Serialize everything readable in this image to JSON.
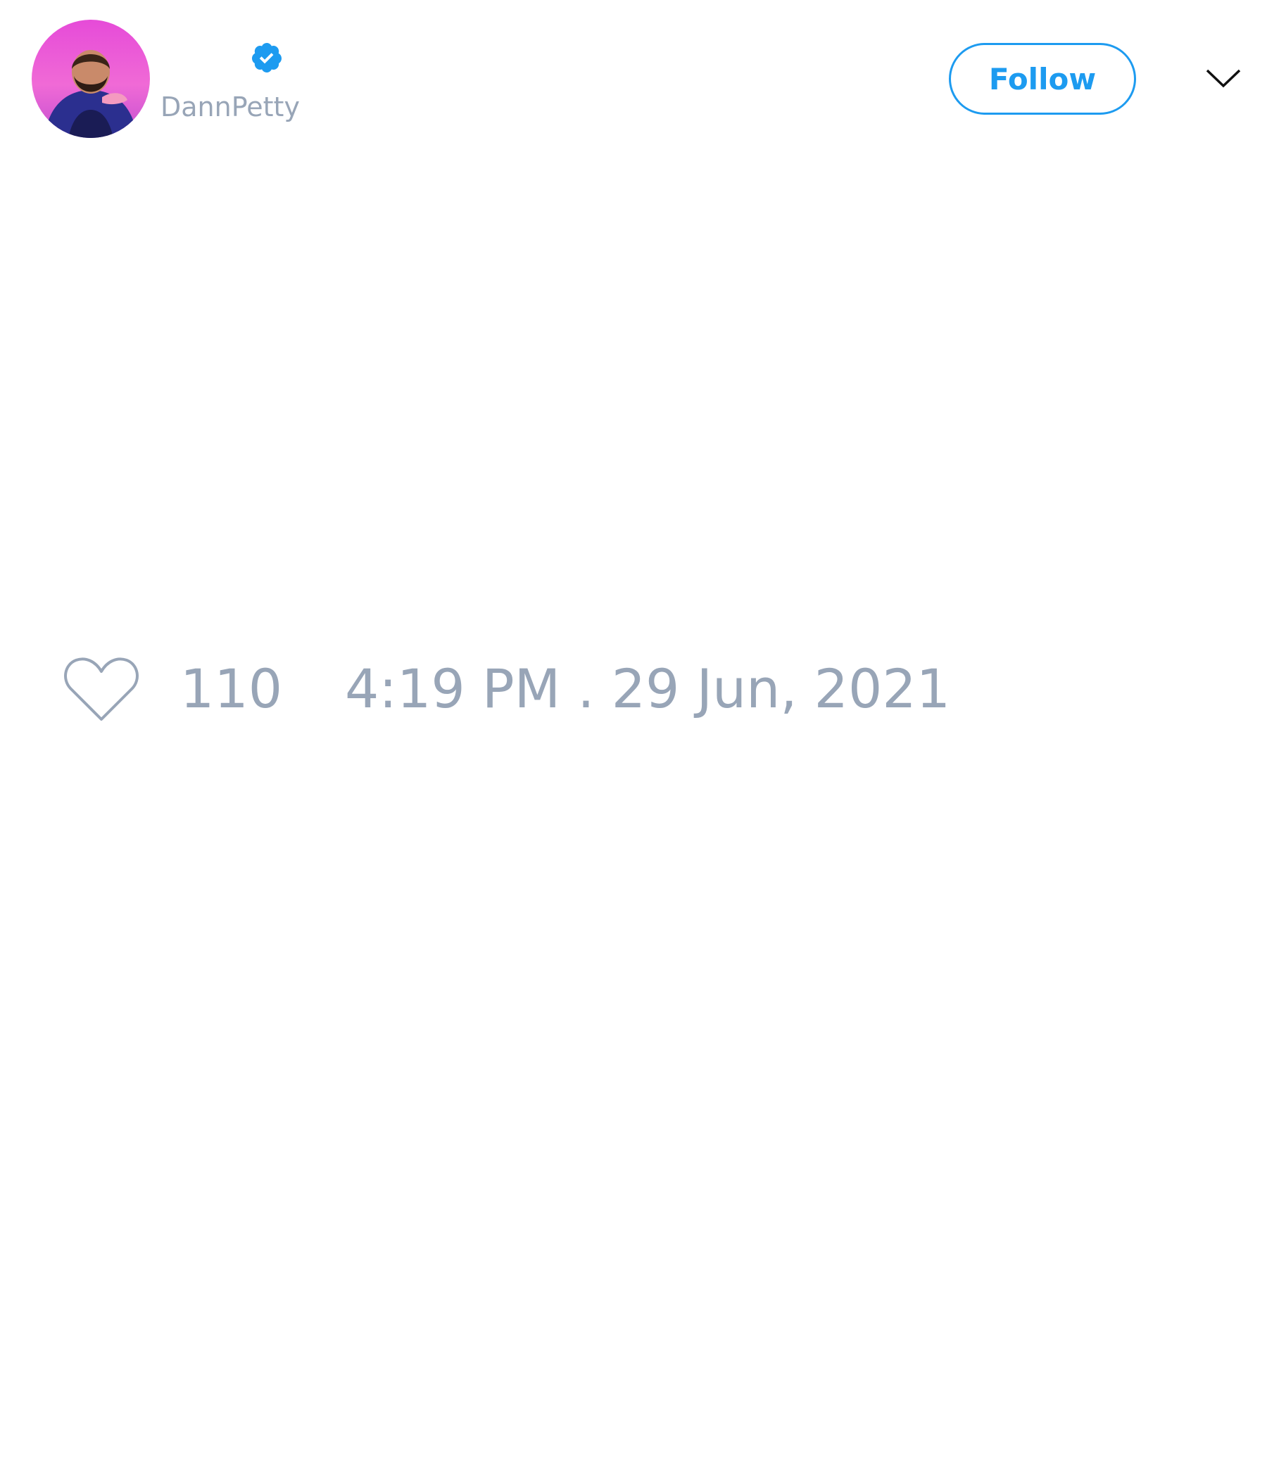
{
  "tweet": {
    "author": {
      "display_name": "",
      "handle": "DannPetty",
      "verified": true
    },
    "follow_label": "Follow",
    "like_count": "110",
    "timestamp": "4:19 PM . 29 Jun, 2021"
  },
  "icons": {
    "verified": "verified-badge-icon",
    "menu": "chevron-down-icon",
    "like": "heart-outline-icon"
  },
  "colors": {
    "accent": "#1d9bf0",
    "muted_text": "#98a5b7",
    "background": "#ffffff",
    "icon_dark": "#111111"
  }
}
